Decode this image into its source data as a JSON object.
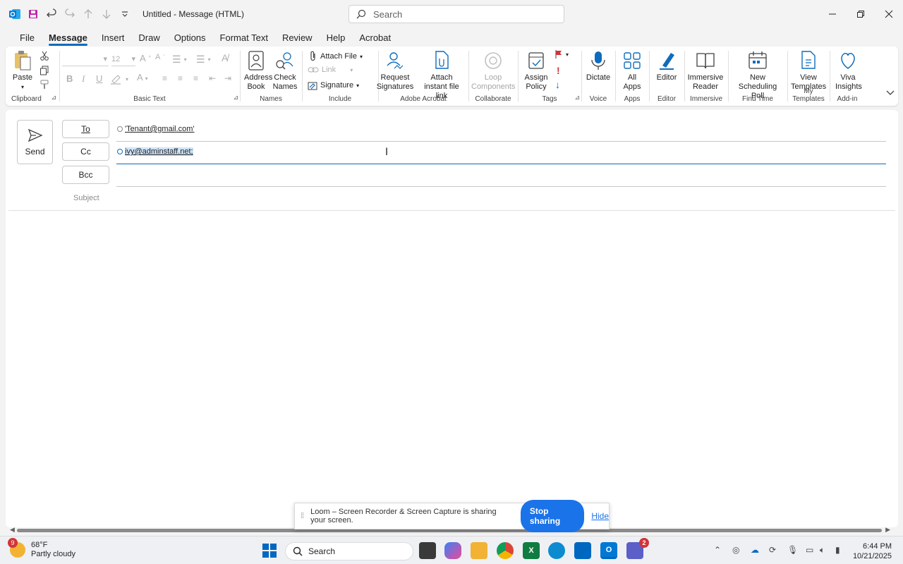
{
  "window": {
    "title": "Untitled  -  Message (HTML)",
    "search_placeholder": "Search"
  },
  "menu_tabs": [
    "File",
    "Message",
    "Insert",
    "Draw",
    "Options",
    "Format Text",
    "Review",
    "Help",
    "Acrobat"
  ],
  "active_tab": "Message",
  "ribbon": {
    "clipboard": {
      "paste": "Paste",
      "label": "Clipboard"
    },
    "basic_text": {
      "font_size": "12",
      "label": "Basic Text"
    },
    "names": {
      "address_book": "Address Book",
      "check_names": "Check Names",
      "label": "Names"
    },
    "include": {
      "attach_file": "Attach File",
      "link": "Link",
      "signature": "Signature",
      "label": "Include"
    },
    "adobe": {
      "request_signatures": "Request Signatures",
      "attach_instant": "Attach instant file link",
      "label": "Adobe Acrobat"
    },
    "collaborate": {
      "loop": "Loop Components",
      "label": "Collaborate"
    },
    "tags": {
      "assign_policy": "Assign Policy",
      "label": "Tags"
    },
    "voice": {
      "dictate": "Dictate",
      "label": "Voice"
    },
    "apps": {
      "all_apps": "All Apps",
      "label": "Apps"
    },
    "editor": {
      "editor": "Editor",
      "label": "Editor"
    },
    "immersive": {
      "reader": "Immersive Reader",
      "label": "Immersive"
    },
    "find_time": {
      "poll": "New Scheduling Poll",
      "label": "Find Time"
    },
    "templates": {
      "view": "View Templates",
      "label": "My Templates"
    },
    "addin": {
      "viva": "Viva Insights",
      "label": "Add-in"
    }
  },
  "compose": {
    "send": "Send",
    "to_label": "To",
    "cc_label": "Cc",
    "bcc_label": "Bcc",
    "subject_label": "Subject",
    "to_value": "'Tenant@gmail.com'",
    "cc_value": "ivy@adminstaff.net;"
  },
  "loom": {
    "message": "Loom – Screen Recorder & Screen Capture is sharing your screen.",
    "stop": "Stop sharing",
    "hide": "Hide"
  },
  "taskbar": {
    "weather_badge": "9",
    "temp": "68°F",
    "condition": "Partly cloudy",
    "search": "Search",
    "teams_badge": "2",
    "time": "6:44 PM",
    "date": "10/21/2025"
  },
  "colors": {
    "accent": "#0f6cbd",
    "selection": "#cfe4fa",
    "loom_blue": "#1a73e8"
  }
}
